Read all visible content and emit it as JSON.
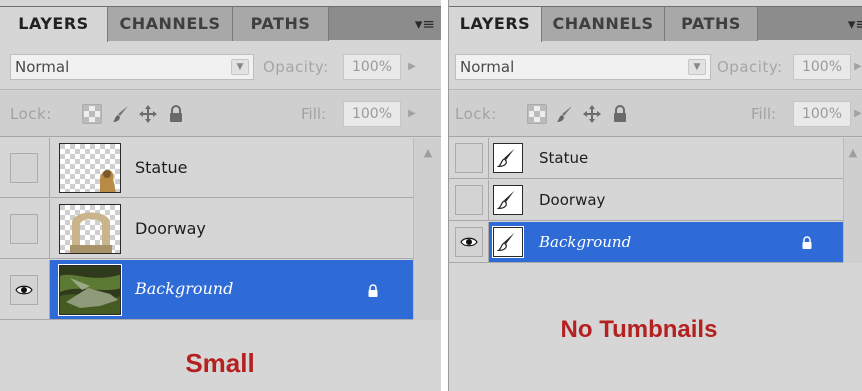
{
  "left_panel": {
    "tabs": [
      "LAYERS",
      "CHANNELS",
      "PATHS"
    ],
    "menu_icon": "panel-menu-icon",
    "blend_mode": "Normal",
    "opacity_label": "Opacity:",
    "opacity_value": "100%",
    "lock_label": "Lock:",
    "fill_label": "Fill:",
    "fill_value": "100%",
    "layers": [
      {
        "name": "Statue",
        "visible": false,
        "selected": false,
        "locked": false
      },
      {
        "name": "Doorway",
        "visible": false,
        "selected": false,
        "locked": false
      },
      {
        "name": "Background",
        "visible": true,
        "selected": true,
        "locked": true
      }
    ],
    "caption": "Small"
  },
  "right_panel": {
    "tabs": [
      "LAYERS",
      "CHANNELS",
      "PATHS"
    ],
    "menu_icon": "panel-menu-icon",
    "blend_mode": "Normal",
    "opacity_label": "Opacity:",
    "opacity_value": "100%",
    "lock_label": "Lock:",
    "fill_label": "Fill:",
    "fill_value": "100%",
    "layers": [
      {
        "name": "Statue",
        "visible": false,
        "selected": false,
        "locked": false
      },
      {
        "name": "Doorway",
        "visible": false,
        "selected": false,
        "locked": false
      },
      {
        "name": "Background",
        "visible": true,
        "selected": true,
        "locked": true
      }
    ],
    "caption": "No Tumbnails"
  },
  "colors": {
    "selection": "#2f6bd6",
    "caption": "#b52020",
    "panel": "#d6d6d6"
  }
}
